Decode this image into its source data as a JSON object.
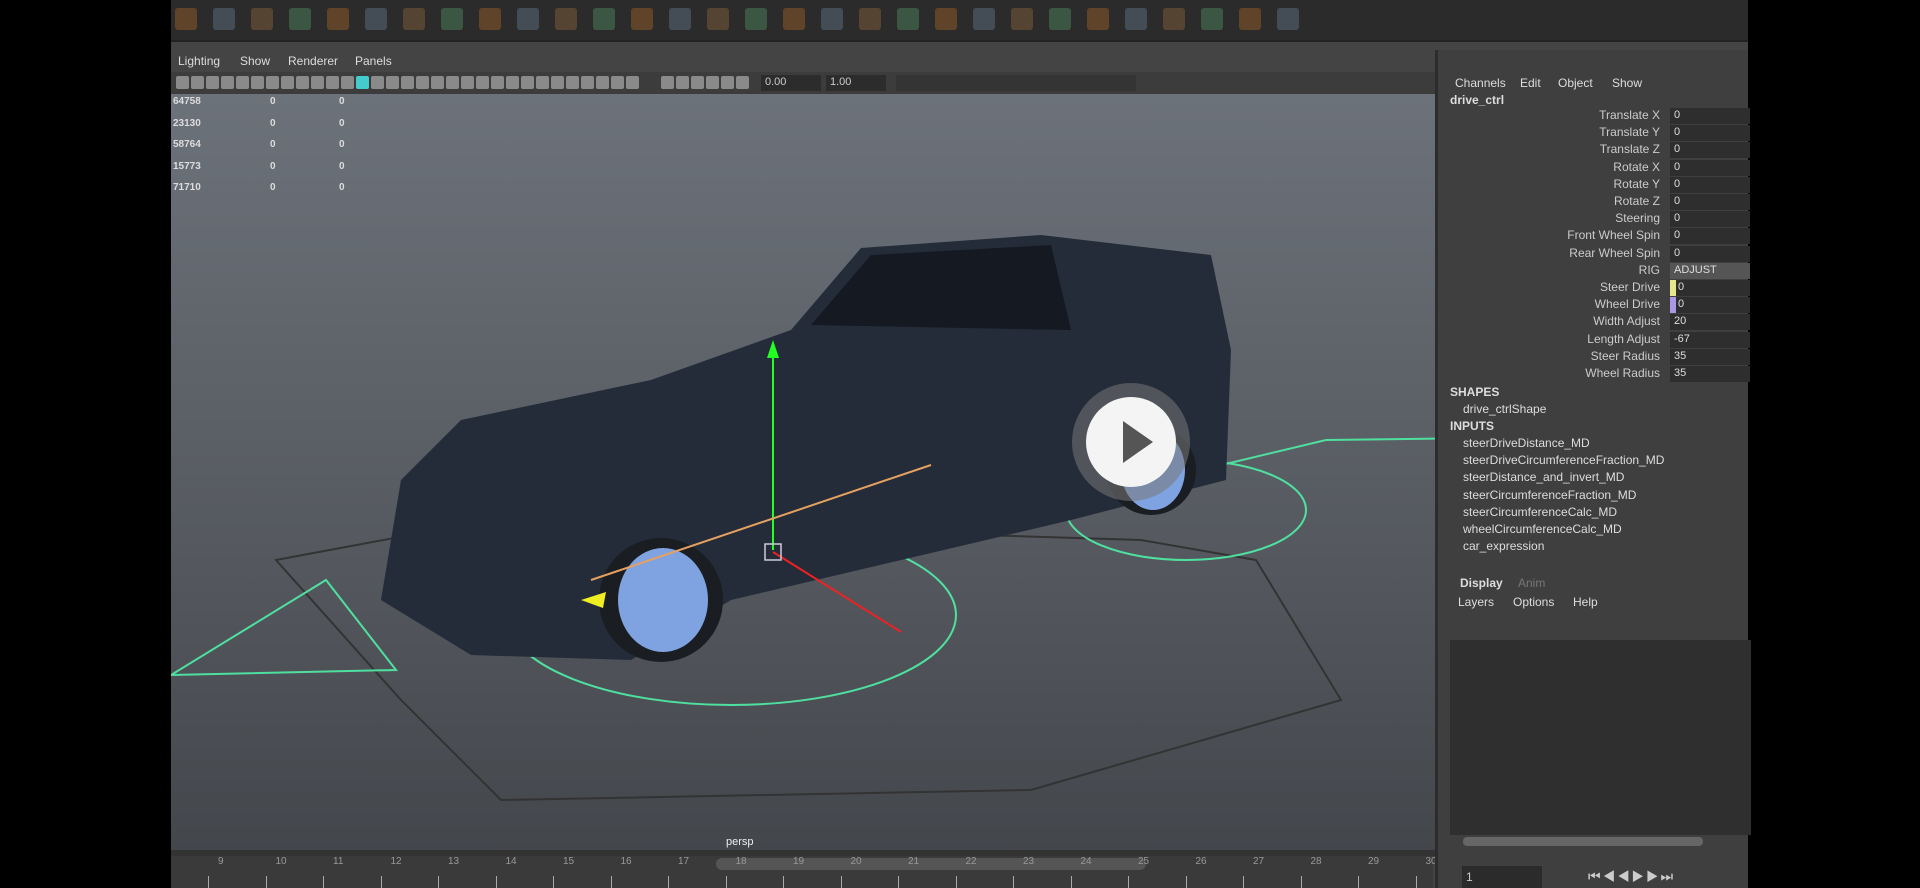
{
  "viewport": {
    "menu": [
      "Lighting",
      "Show",
      "Renderer",
      "Panels"
    ],
    "exposure": "0.00",
    "gamma": "1.00",
    "camera_label": "persp",
    "hud_rows": [
      [
        "64758",
        "0",
        "0"
      ],
      [
        "23130",
        "0",
        "0"
      ],
      [
        "58764",
        "0",
        "0"
      ],
      [
        "15773",
        "0",
        "0"
      ],
      [
        "71710",
        "0",
        "0"
      ]
    ]
  },
  "channel_box": {
    "menu": [
      "Channels",
      "Edit",
      "Object",
      "Show"
    ],
    "object_name": "drive_ctrl",
    "attributes": [
      {
        "label": "Translate X",
        "value": "0"
      },
      {
        "label": "Translate Y",
        "value": "0"
      },
      {
        "label": "Translate Z",
        "value": "0"
      },
      {
        "label": "Rotate X",
        "value": "0"
      },
      {
        "label": "Rotate Y",
        "value": "0"
      },
      {
        "label": "Rotate Z",
        "value": "0"
      },
      {
        "label": "Steering",
        "value": "0"
      },
      {
        "label": "Front Wheel Spin",
        "value": "0"
      },
      {
        "label": "Rear Wheel Spin",
        "value": "0"
      },
      {
        "label": "RIG",
        "value": "ADJUST"
      },
      {
        "label": "Steer Drive",
        "value": "0",
        "color": "#e6e68a"
      },
      {
        "label": "Wheel Drive",
        "value": "0",
        "color": "#a898e6"
      },
      {
        "label": "Width Adjust",
        "value": "20"
      },
      {
        "label": "Length Adjust",
        "value": "-67"
      },
      {
        "label": "Steer Radius",
        "value": "35"
      },
      {
        "label": "Wheel Radius",
        "value": "35"
      }
    ],
    "shapes_header": "SHAPES",
    "shapes": [
      "drive_ctrlShape"
    ],
    "inputs_header": "INPUTS",
    "inputs": [
      "steerDriveDistance_MD",
      "steerDriveCircumferenceFraction_MD",
      "steerDistance_and_invert_MD",
      "steerCircumferenceFraction_MD",
      "steerCircumferenceCalc_MD",
      "wheelCircumferenceCalc_MD",
      "car_expression"
    ]
  },
  "layer_editor": {
    "tabs": [
      "Display",
      "Anim"
    ],
    "menu": [
      "Layers",
      "Options",
      "Help"
    ]
  },
  "timeline": {
    "ticks": [
      "9",
      "10",
      "11",
      "12",
      "13",
      "14",
      "15",
      "16",
      "17",
      "18",
      "19",
      "20",
      "21",
      "22",
      "23",
      "24",
      "25",
      "26",
      "27",
      "28",
      "29",
      "30"
    ],
    "current_frame": "1"
  },
  "colors": {
    "wire": "#4fe0a0",
    "tire": "#1a1d22",
    "rim": "#7fa3e0",
    "body": "#232c38"
  }
}
